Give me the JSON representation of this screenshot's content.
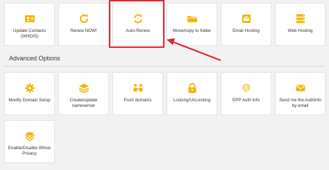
{
  "accent_color": "#f5b400",
  "highlight_color": "#e0262b",
  "row1": [
    {
      "label": "Update Contacts (WHOIS)",
      "icon": "contact-card-icon"
    },
    {
      "label": "Renew NOW!",
      "icon": "renew-icon"
    },
    {
      "label": "Auto-Renew",
      "icon": "auto-renew-icon"
    },
    {
      "label": "Move/copy to folder",
      "icon": "folder-icon"
    },
    {
      "label": "Email Hosting",
      "icon": "email-icon"
    },
    {
      "label": "Web Hosting",
      "icon": "web-hosting-icon"
    }
  ],
  "section": {
    "title": "Advanced Options"
  },
  "row2": [
    {
      "label": "Modify Domain Setup",
      "icon": "gear-icon"
    },
    {
      "label": "Create/update nameserver",
      "icon": "layers-icon"
    },
    {
      "label": "Push domains",
      "icon": "push-domains-icon"
    },
    {
      "label": "Locking/UnLocking",
      "icon": "lock-icon"
    },
    {
      "label": "EPP Auth Info",
      "icon": "fingerprint-icon"
    },
    {
      "label": "Send me the AuthInfo by email",
      "icon": "email-icon"
    }
  ],
  "row3": [
    {
      "label": "Enable/Disable Whois Privacy",
      "icon": "privacy-icon"
    }
  ]
}
